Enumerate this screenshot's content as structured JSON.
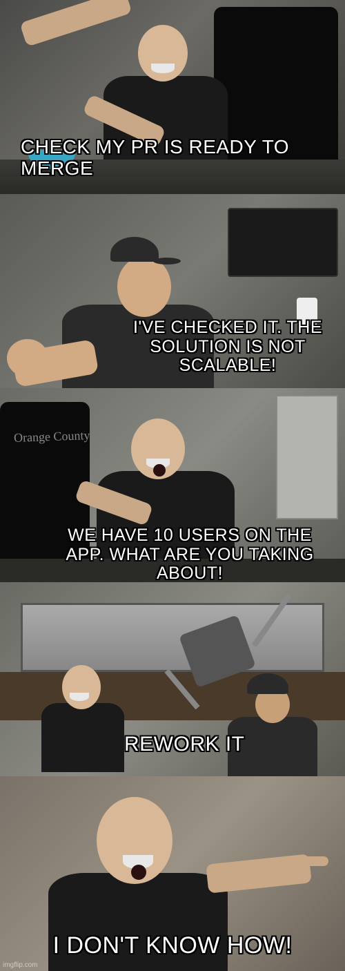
{
  "panels": {
    "p1": {
      "caption": "CHECK MY PR IS READY TO MERGE"
    },
    "p2": {
      "caption": "I'VE CHECKED IT. THE SOLUTION IS NOT SCALABLE!"
    },
    "p3": {
      "caption": "WE HAVE 10 USERS ON THE APP. WHAT ARE YOU TAKING ABOUT!",
      "chair_text": "Orange County"
    },
    "p4": {
      "caption": "REWORK IT"
    },
    "p5": {
      "caption": "I DON'T KNOW HOW!"
    }
  },
  "watermark": "imgflip.com"
}
